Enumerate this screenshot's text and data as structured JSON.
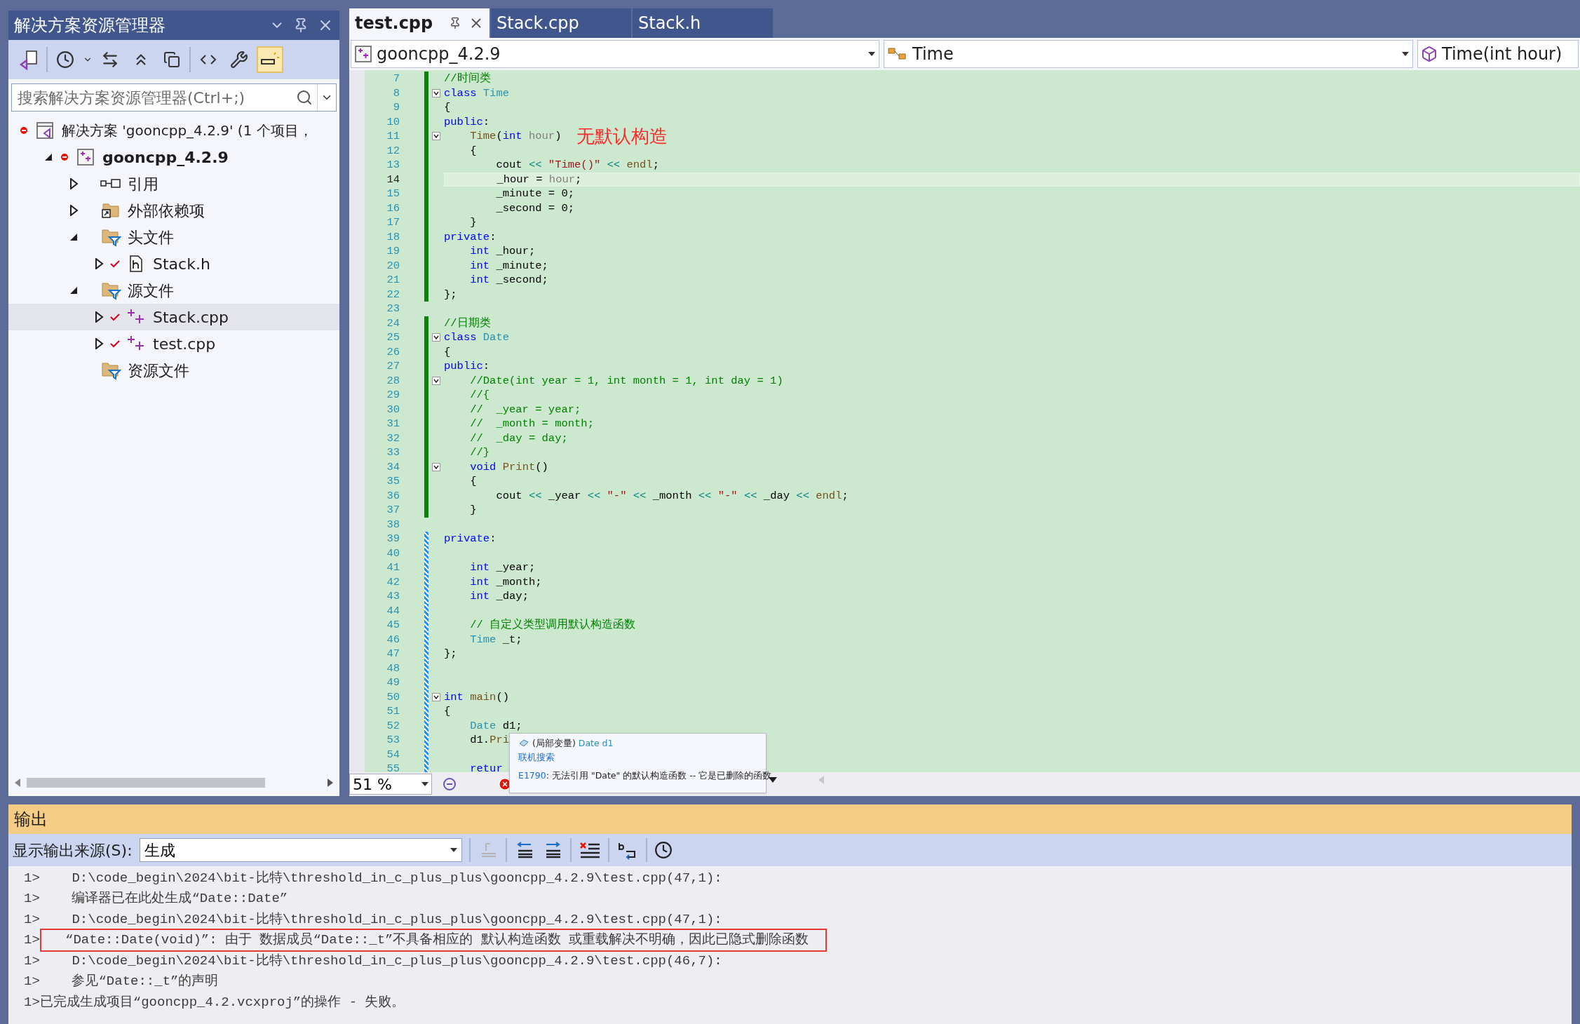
{
  "solution_explorer": {
    "title": "解决方案资源管理器",
    "search": {
      "placeholder": "搜索解决方案资源管理器(Ctrl+;)"
    },
    "tree": [
      {
        "kind": "solution",
        "label": "解决方案 'gooncpp_4.2.9' (1 个项目，",
        "error": true,
        "selected": false,
        "children": [
          {
            "kind": "project",
            "label": "gooncpp_4.2.9",
            "error": true,
            "selected": false,
            "expanded": true,
            "children": [
              {
                "kind": "references",
                "label": "引用",
                "selected": false,
                "expanded": false
              },
              {
                "kind": "external",
                "label": "外部依赖项",
                "selected": false,
                "expanded": false
              },
              {
                "kind": "filter",
                "label": "头文件",
                "selected": false,
                "expanded": true,
                "children": [
                  {
                    "kind": "header",
                    "label": "Stack.h",
                    "checked": true,
                    "selected": false,
                    "expanded": false
                  }
                ]
              },
              {
                "kind": "filter",
                "label": "源文件",
                "selected": false,
                "expanded": true,
                "children": [
                  {
                    "kind": "source",
                    "label": "Stack.cpp",
                    "checked": true,
                    "selected": true,
                    "expanded": false
                  },
                  {
                    "kind": "source",
                    "label": "test.cpp",
                    "checked": true,
                    "selected": false,
                    "expanded": false
                  }
                ]
              },
              {
                "kind": "filter",
                "label": "资源文件",
                "selected": false
              }
            ]
          }
        ]
      }
    ]
  },
  "editor": {
    "tabs": [
      {
        "label": "test.cpp",
        "selected": true,
        "pinned": true
      },
      {
        "label": "Stack.cpp",
        "selected": false,
        "pinned": false
      },
      {
        "label": "Stack.h",
        "selected": false,
        "pinned": false
      }
    ],
    "nav": [
      {
        "kind": "project",
        "label": "gooncpp_4.2.9"
      },
      {
        "kind": "class",
        "label": "Time"
      },
      {
        "kind": "member",
        "label": "Time(int hour)"
      }
    ],
    "lines": [
      {
        "number": "7",
        "current": false,
        "kind": "saved",
        "tokens": [
          {
            "kind": "comment",
            "text": "//时间类"
          }
        ]
      },
      {
        "number": "8",
        "current": false,
        "kind": "saved",
        "fold": true,
        "tokens": [
          {
            "kind": "kw",
            "text": "class"
          },
          {
            "kind": "type",
            "text": " Time"
          }
        ]
      },
      {
        "number": "9",
        "current": false,
        "kind": "saved",
        "tokens": [
          {
            "kind": "plain",
            "text": "{"
          }
        ]
      },
      {
        "number": "10",
        "current": false,
        "kind": "saved",
        "tokens": [
          {
            "kind": "kw",
            "text": "public"
          },
          {
            "kind": "plain",
            "text": ":"
          }
        ]
      },
      {
        "number": "11",
        "current": false,
        "kind": "saved",
        "fold": true,
        "note": "无默认构造",
        "tokens": [
          {
            "kind": "fn",
            "text": "    Time"
          },
          {
            "kind": "plain",
            "text": "("
          },
          {
            "kind": "kw",
            "text": "int"
          },
          {
            "kind": "param",
            "text": " hour"
          },
          {
            "kind": "plain",
            "text": ")"
          }
        ]
      },
      {
        "number": "12",
        "current": false,
        "kind": "saved",
        "tokens": [
          {
            "kind": "plain",
            "text": "    {"
          }
        ]
      },
      {
        "number": "13",
        "current": false,
        "kind": "saved",
        "tokens": [
          {
            "kind": "plain",
            "text": "        cout "
          },
          {
            "kind": "op",
            "text": "<<"
          },
          {
            "kind": "string",
            "text": " \"Time()\" "
          },
          {
            "kind": "op",
            "text": "<<"
          },
          {
            "kind": "fn",
            "text": " endl"
          },
          {
            "kind": "plain",
            "text": ";"
          }
        ]
      },
      {
        "number": "14",
        "current": true,
        "kind": "saved",
        "tokens": [
          {
            "kind": "plain",
            "text": "        _hour = "
          },
          {
            "kind": "param",
            "text": "hour"
          },
          {
            "kind": "plain",
            "text": ";"
          }
        ]
      },
      {
        "number": "15",
        "current": false,
        "kind": "saved",
        "tokens": [
          {
            "kind": "plain",
            "text": "        _minute = 0;"
          }
        ]
      },
      {
        "number": "16",
        "current": false,
        "kind": "saved",
        "tokens": [
          {
            "kind": "plain",
            "text": "        _second = 0;"
          }
        ]
      },
      {
        "number": "17",
        "current": false,
        "kind": "saved",
        "tokens": [
          {
            "kind": "plain",
            "text": "    }"
          }
        ]
      },
      {
        "number": "18",
        "current": false,
        "kind": "saved",
        "tokens": [
          {
            "kind": "kw",
            "text": "private"
          },
          {
            "kind": "plain",
            "text": ":"
          }
        ]
      },
      {
        "number": "19",
        "current": false,
        "kind": "saved",
        "tokens": [
          {
            "kind": "kw",
            "text": "    int"
          },
          {
            "kind": "plain",
            "text": " _hour;"
          }
        ]
      },
      {
        "number": "20",
        "current": false,
        "kind": "saved",
        "tokens": [
          {
            "kind": "kw",
            "text": "    int"
          },
          {
            "kind": "plain",
            "text": " _minute;"
          }
        ]
      },
      {
        "number": "21",
        "current": false,
        "kind": "saved",
        "tokens": [
          {
            "kind": "kw",
            "text": "    int"
          },
          {
            "kind": "plain",
            "text": " _second;"
          }
        ]
      },
      {
        "number": "22",
        "current": false,
        "kind": "saved",
        "tokens": [
          {
            "kind": "plain",
            "text": "};"
          }
        ]
      },
      {
        "number": "23",
        "current": false,
        "kind": "unchanged"
      },
      {
        "number": "24",
        "current": false,
        "kind": "saved",
        "tokens": [
          {
            "kind": "comment",
            "text": "//日期类"
          }
        ]
      },
      {
        "number": "25",
        "current": false,
        "kind": "saved",
        "fold": true,
        "tokens": [
          {
            "kind": "kw",
            "text": "class"
          },
          {
            "kind": "type",
            "text": " Date"
          }
        ]
      },
      {
        "number": "26",
        "current": false,
        "kind": "saved",
        "tokens": [
          {
            "kind": "plain",
            "text": "{"
          }
        ]
      },
      {
        "number": "27",
        "current": false,
        "kind": "saved",
        "tokens": [
          {
            "kind": "kw",
            "text": "public"
          },
          {
            "kind": "plain",
            "text": ":"
          }
        ]
      },
      {
        "number": "28",
        "current": false,
        "kind": "saved",
        "fold": true,
        "tokens": [
          {
            "kind": "comment",
            "text": "    //Date(int year = 1, int month = 1, int day = 1)"
          }
        ]
      },
      {
        "number": "29",
        "current": false,
        "kind": "saved",
        "tokens": [
          {
            "kind": "comment",
            "text": "    //{"
          }
        ]
      },
      {
        "number": "30",
        "current": false,
        "kind": "saved",
        "tokens": [
          {
            "kind": "comment",
            "text": "    //  _year = year;"
          }
        ]
      },
      {
        "number": "31",
        "current": false,
        "kind": "saved",
        "tokens": [
          {
            "kind": "comment",
            "text": "    //  _month = month;"
          }
        ]
      },
      {
        "number": "32",
        "current": false,
        "kind": "saved",
        "tokens": [
          {
            "kind": "comment",
            "text": "    //  _day = day;"
          }
        ]
      },
      {
        "number": "33",
        "current": false,
        "kind": "saved",
        "tokens": [
          {
            "kind": "comment",
            "text": "    //}"
          }
        ]
      },
      {
        "number": "34",
        "current": false,
        "kind": "saved",
        "fold": true,
        "tokens": [
          {
            "kind": "kw",
            "text": "    void"
          },
          {
            "kind": "fn",
            "text": " Print"
          },
          {
            "kind": "plain",
            "text": "()"
          }
        ]
      },
      {
        "number": "35",
        "current": false,
        "kind": "saved",
        "tokens": [
          {
            "kind": "plain",
            "text": "    {"
          }
        ]
      },
      {
        "number": "36",
        "current": false,
        "kind": "saved",
        "tokens": [
          {
            "kind": "plain",
            "text": "        cout "
          },
          {
            "kind": "op",
            "text": "<<"
          },
          {
            "kind": "plain",
            "text": " _year "
          },
          {
            "kind": "op",
            "text": "<<"
          },
          {
            "kind": "string",
            "text": " \"-\" "
          },
          {
            "kind": "op",
            "text": "<<"
          },
          {
            "kind": "plain",
            "text": " _month "
          },
          {
            "kind": "op",
            "text": "<<"
          },
          {
            "kind": "string",
            "text": " \"-\" "
          },
          {
            "kind": "op",
            "text": "<<"
          },
          {
            "kind": "plain",
            "text": " _day "
          },
          {
            "kind": "op",
            "text": "<<"
          },
          {
            "kind": "fn",
            "text": " endl"
          },
          {
            "kind": "plain",
            "text": ";"
          }
        ]
      },
      {
        "number": "37",
        "current": false,
        "kind": "saved",
        "tokens": [
          {
            "kind": "plain",
            "text": "    }"
          }
        ]
      },
      {
        "number": "38",
        "current": false,
        "kind": "unchanged"
      },
      {
        "number": "39",
        "current": false,
        "kind": "unsaved",
        "tokens": [
          {
            "kind": "kw",
            "text": "private"
          },
          {
            "kind": "plain",
            "text": ":"
          }
        ]
      },
      {
        "number": "40",
        "current": false,
        "kind": "unsaved"
      },
      {
        "number": "41",
        "current": false,
        "kind": "unsaved",
        "tokens": [
          {
            "kind": "kw",
            "text": "    int"
          },
          {
            "kind": "plain",
            "text": " _year;"
          }
        ]
      },
      {
        "number": "42",
        "current": false,
        "kind": "unsaved",
        "tokens": [
          {
            "kind": "kw",
            "text": "    int"
          },
          {
            "kind": "plain",
            "text": " _month;"
          }
        ]
      },
      {
        "number": "43",
        "current": false,
        "kind": "unsaved",
        "tokens": [
          {
            "kind": "kw",
            "text": "    int"
          },
          {
            "kind": "plain",
            "text": " _day;"
          }
        ]
      },
      {
        "number": "44",
        "current": false,
        "kind": "unsaved"
      },
      {
        "number": "45",
        "current": false,
        "kind": "unsaved",
        "tokens": [
          {
            "kind": "comment",
            "text": "    // 自定义类型调用默认构造函数"
          }
        ]
      },
      {
        "number": "46",
        "current": false,
        "kind": "unsaved",
        "tokens": [
          {
            "kind": "type",
            "text": "    Time"
          },
          {
            "kind": "plain",
            "text": " _t;"
          }
        ]
      },
      {
        "number": "47",
        "current": false,
        "kind": "unsaved",
        "tokens": [
          {
            "kind": "plain",
            "text": "};"
          }
        ]
      },
      {
        "number": "48",
        "current": false,
        "kind": "unsaved"
      },
      {
        "number": "49",
        "current": false,
        "kind": "unsaved"
      },
      {
        "number": "50",
        "current": false,
        "kind": "unsaved",
        "fold": true,
        "tokens": [
          {
            "kind": "kw",
            "text": "int"
          },
          {
            "kind": "fn",
            "text": " main"
          },
          {
            "kind": "plain",
            "text": "()"
          }
        ]
      },
      {
        "number": "51",
        "current": false,
        "kind": "unsaved",
        "tokens": [
          {
            "kind": "plain",
            "text": "{"
          }
        ]
      },
      {
        "number": "52",
        "current": false,
        "kind": "unsaved",
        "tokens": [
          {
            "kind": "type",
            "text": "    Date"
          },
          {
            "kind": "plain",
            "text": " d1;"
          }
        ]
      },
      {
        "number": "53",
        "current": false,
        "kind": "unsaved",
        "tokens": [
          {
            "kind": "plain",
            "text": "    d1."
          },
          {
            "kind": "fn",
            "text": "Pri"
          }
        ]
      },
      {
        "number": "54",
        "current": false,
        "kind": "unsaved"
      },
      {
        "number": "55",
        "current": false,
        "kind": "unsaved",
        "tokens": [
          {
            "kind": "kw",
            "text": "    retur"
          }
        ]
      }
    ],
    "tooltip": {
      "scope": "(局部变量)",
      "symbol": "Date d1",
      "link": "联机搜索",
      "error_code": "E1790",
      "error_text": ": 无法引用 \"Date\" 的默认构造函数 -- 它是已删除的函数"
    },
    "zoom": "51 %"
  },
  "output": {
    "title": "输出",
    "source_label": "显示输出来源(S):",
    "source": "生成",
    "lines": [
      {
        "prefix": "1>",
        "text": "    D:\\code_begin\\2024\\bit-比特\\threshold_in_c_plus_plus\\gooncpp_4.2.9\\test.cpp(47,1):",
        "highlighted": false
      },
      {
        "prefix": "1>",
        "text": "    编译器已在此处生成“Date::Date”",
        "highlighted": false
      },
      {
        "prefix": "1>",
        "text": "    D:\\code_begin\\2024\\bit-比特\\threshold_in_c_plus_plus\\gooncpp_4.2.9\\test.cpp(47,1):",
        "highlighted": false
      },
      {
        "prefix": "1>",
        "text": "   “Date::Date(void)”: 由于 数据成员“Date::_t”不具备相应的 默认构造函数 或重载解决不明确，因此已隐式删除函数",
        "highlighted": true
      },
      {
        "prefix": "1>",
        "text": "    D:\\code_begin\\2024\\bit-比特\\threshold_in_c_plus_plus\\gooncpp_4.2.9\\test.cpp(46,7):",
        "highlighted": false
      },
      {
        "prefix": "1>",
        "text": "    参见“Date::_t”的声明",
        "highlighted": false
      },
      {
        "prefix": "1>",
        "text": "已完成生成项目“gooncpp_4.2.vcxproj”的操作 - 失败。",
        "highlighted": false
      }
    ]
  }
}
